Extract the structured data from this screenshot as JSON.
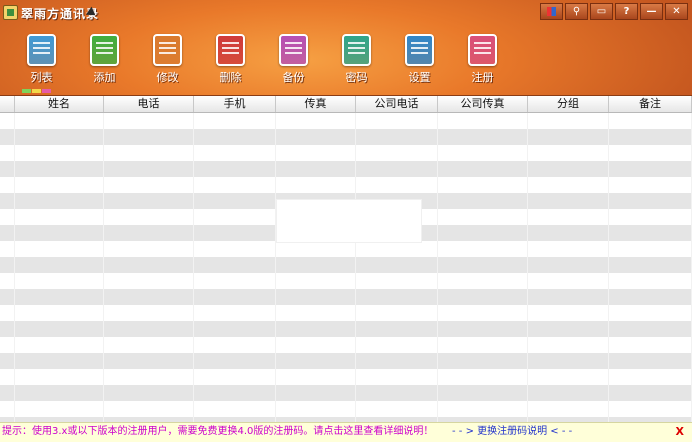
{
  "window": {
    "title": "翠雨方通讯录"
  },
  "toolbar": [
    {
      "label": "列表",
      "icon": "list-icon",
      "color": "#3f9ad6"
    },
    {
      "label": "添加",
      "icon": "add-icon",
      "color": "#3fae3f"
    },
    {
      "label": "修改",
      "icon": "edit-icon",
      "color": "#d97a2f"
    },
    {
      "label": "删除",
      "icon": "delete-icon",
      "color": "#cf3a3a"
    },
    {
      "label": "备份",
      "icon": "backup-icon",
      "color": "#b64fb5"
    },
    {
      "label": "密码",
      "icon": "password-icon",
      "color": "#2fa58a"
    },
    {
      "label": "设置",
      "icon": "settings-icon",
      "color": "#2f86c9"
    },
    {
      "label": "注册",
      "icon": "register-icon",
      "color": "#d94f7a"
    }
  ],
  "table": {
    "columns": [
      "姓名",
      "电话",
      "手机",
      "传真",
      "公司电话",
      "公司传真",
      "分组",
      "备注"
    ]
  },
  "window_buttons": {
    "help": "?",
    "minimize": "—",
    "close": "✕"
  },
  "status": {
    "tip": "提示：使用3.x或以下版本的注册用户，需要免费更换4.0版的注册码。请点击这里查看详细说明！",
    "link": "- - > 更换注册码说明 < - -",
    "close": "X"
  }
}
